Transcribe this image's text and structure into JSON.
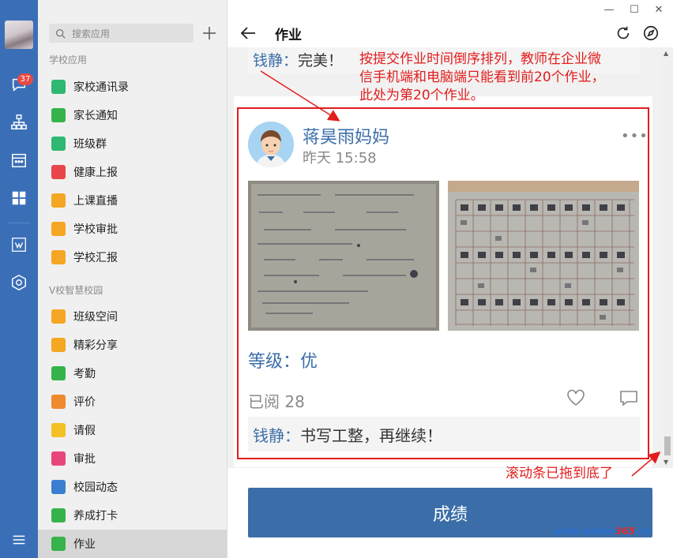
{
  "rail": {
    "badge_count": "37",
    "icons": [
      "chat-icon",
      "org-chart-icon",
      "calendar-icon",
      "apps-icon",
      "work-icon",
      "cube-icon",
      "menu-icon"
    ]
  },
  "panel": {
    "search_placeholder": "搜索应用",
    "section1": "学校应用",
    "section2": "V校智慧校园",
    "items1": [
      {
        "label": "家校通讯录",
        "color": "#2eb872",
        "icon": "contacts-icon"
      },
      {
        "label": "家长通知",
        "color": "#36b34a",
        "icon": "notice-icon"
      },
      {
        "label": "班级群",
        "color": "#2eb872",
        "icon": "group-icon"
      },
      {
        "label": "健康上报",
        "color": "#e8464a",
        "icon": "health-icon"
      },
      {
        "label": "上课直播",
        "color": "#f5a623",
        "icon": "live-icon"
      },
      {
        "label": "学校审批",
        "color": "#f5a623",
        "icon": "approval-icon"
      },
      {
        "label": "学校汇报",
        "color": "#f5a623",
        "icon": "report-icon"
      }
    ],
    "items2": [
      {
        "label": "班级空间",
        "color": "#f5a623",
        "icon": "space-icon"
      },
      {
        "label": "精彩分享",
        "color": "#f5a623",
        "icon": "camera-icon"
      },
      {
        "label": "考勤",
        "color": "#36b34a",
        "icon": "attendance-icon"
      },
      {
        "label": "评价",
        "color": "#ef8a2f",
        "icon": "medal-icon"
      },
      {
        "label": "请假",
        "color": "#f5c023",
        "icon": "leave-icon"
      },
      {
        "label": "审批",
        "color": "#e8467a",
        "icon": "audit-icon"
      },
      {
        "label": "校园动态",
        "color": "#3a7fd0",
        "icon": "pinwheel-icon"
      },
      {
        "label": "养成打卡",
        "color": "#36b34a",
        "icon": "checkin-icon"
      },
      {
        "label": "作业",
        "color": "#36b34a",
        "icon": "homework-icon"
      }
    ]
  },
  "main": {
    "title": "作业",
    "prev_comment_name": "钱静：",
    "prev_comment_text": "完美！",
    "post": {
      "author": "蒋昊雨妈妈",
      "time": "昨天 15:58",
      "more": "•••",
      "grade": "等级：优",
      "read": "已阅 28",
      "comment_name": "钱静：",
      "comment_text": "书写工整，再继续！"
    },
    "footer_button": "成绩"
  },
  "annotations": {
    "top": [
      "按提交作业时间倒序排列，教师在企业微",
      "信手机端和电脑端只能看到前20个作业，",
      "此处为第20个作业。"
    ],
    "bottom": "滚动条已拖到底了",
    "color": "#e31c1c"
  },
  "watermark": {
    "a": "www.",
    "b": "admin",
    "c": "365",
    "d": ".cn"
  }
}
